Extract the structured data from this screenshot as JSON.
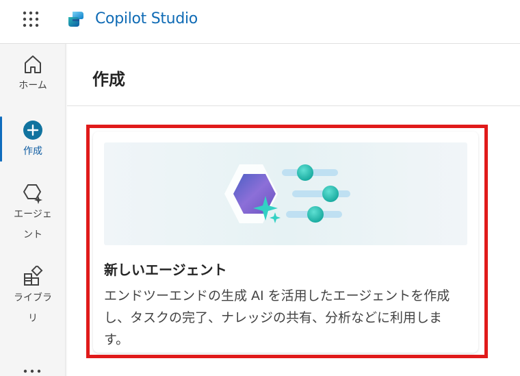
{
  "header": {
    "app_title": "Copilot Studio",
    "launcher_icon": "app-launcher-icon",
    "logo_icon": "copilot-studio-logo"
  },
  "nav": {
    "items": [
      {
        "label": "ホーム",
        "icon": "home-icon",
        "active": false
      },
      {
        "label": "作成",
        "icon": "add-circle-icon",
        "active": true
      },
      {
        "label_line1": "エージェ",
        "label_line2": "ント",
        "icon": "agent-icon",
        "active": false
      },
      {
        "label_line1": "ライブラ",
        "label_line2": "リ",
        "icon": "library-icon",
        "active": false
      }
    ],
    "more_icon": "more-icon"
  },
  "main": {
    "title": "作成",
    "card": {
      "title": "新しいエージェント",
      "description": "エンドツーエンドの生成 AI を活用したエージェントを作成し、タスクの完了、ナレッジの共有、分析などに利用します。"
    }
  },
  "colors": {
    "brand": "#0f6bb5",
    "highlight": "#e01a1a",
    "accent_teal": "#2fc5b8",
    "active_nav": "#0f6cbd"
  }
}
